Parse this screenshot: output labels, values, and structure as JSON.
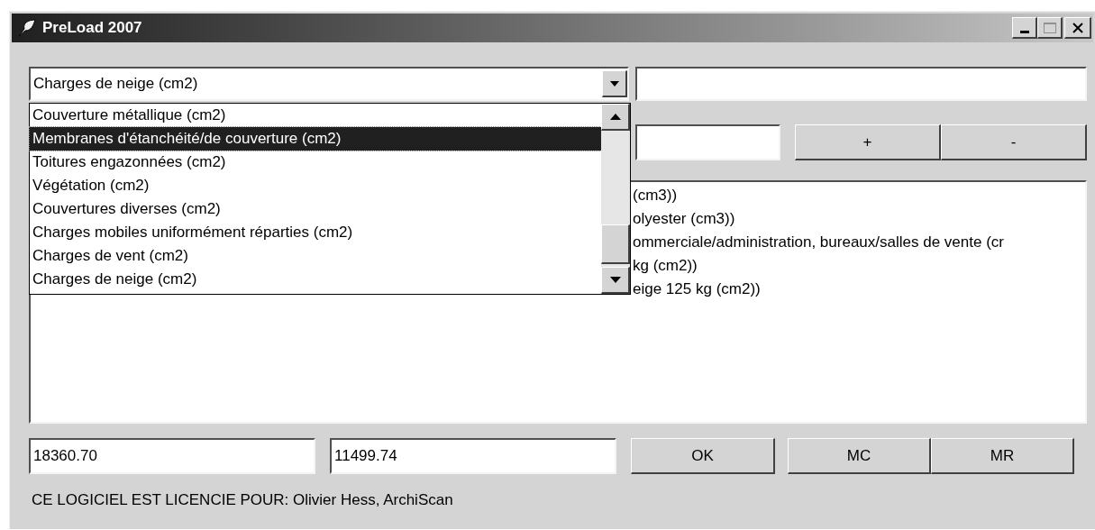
{
  "window": {
    "title": "PreLoad 2007"
  },
  "combo": {
    "value": "Charges de neige (cm2)",
    "expanded": true
  },
  "dropdown_items": [
    {
      "label": "Couverture métallique (cm2)",
      "selected": false
    },
    {
      "label": "Membranes d'étanchéité/de couverture (cm2)",
      "selected": true
    },
    {
      "label": "Toitures engazonnées (cm2)",
      "selected": false
    },
    {
      "label": "Végétation (cm2)",
      "selected": false
    },
    {
      "label": "Couvertures diverses (cm2)",
      "selected": false
    },
    {
      "label": "Charges mobiles uniformément réparties (cm2)",
      "selected": false
    },
    {
      "label": "Charges de vent (cm2)",
      "selected": false
    },
    {
      "label": "Charges de neige (cm2)",
      "selected": false
    }
  ],
  "step_buttons": [
    "+",
    "-"
  ],
  "list_lines": [
    "(cm3))",
    "olyester (cm3))",
    "ommerciale/administration, bureaux/salles de vente (cr",
    "kg (cm2))",
    "eige 125 kg (cm2))"
  ],
  "totals": [
    "18360.70",
    "11499.74"
  ],
  "buttons": [
    "OK",
    "MC",
    "MR"
  ],
  "license": "CE LOGICIEL EST LICENCIE POUR: Olivier Hess, ArchiScan"
}
